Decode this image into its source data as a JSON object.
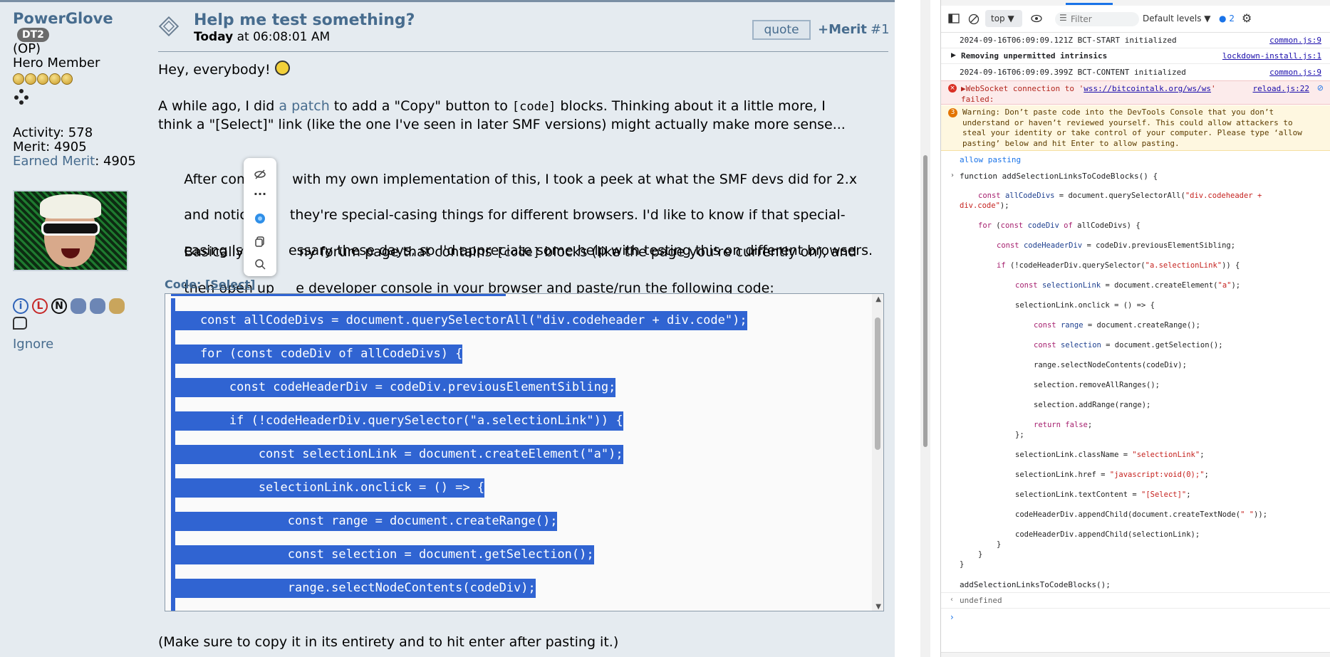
{
  "forum": {
    "poster": {
      "name": "PowerGlove",
      "badge": "DT2",
      "op": "(OP)",
      "rank": "Hero Member",
      "activity": "Activity: 578",
      "merit": "Merit: 4905",
      "earned_label": "Earned Merit",
      "earned_value": ": 4905",
      "ignore": "Ignore"
    },
    "post": {
      "title": "Help me test something?",
      "date_day": "Today",
      "date_time": " at 06:08:01 AM",
      "quote_label": "quote",
      "merit_label": "+Merit",
      "post_number": "#1",
      "p1": "Hey, everybody! ",
      "p2a": "A while ago, I did ",
      "p2_link": "a patch",
      "p2b": " to add a \"Copy\" button to ",
      "p2_code": "[code]",
      "p2c": " blocks. Thinking about it a little more, I",
      "p2d": "think a \"[Select]\" link (like the one I've seen in later SMF versions) might actually make more sense...",
      "p3a": "After coming     with my own implementation of this, I took a peek at what the SMF devs did for 2.x",
      "p3b": "and noticed      they're special-casing things for different browsers. I'd like to know if that special-",
      "p3c": "casing is stil     essary these days, so I'd appreciate some help with testing this on different browsers.",
      "p4a": "Basically, go       ny forum page that contains ",
      "p4_code": "[code]",
      "p4b": " blocks (like the page you're currently on), and",
      "p4c": "then open up     e developer console in your browser and paste/run the following code:",
      "code_label": "Code:",
      "code_select": "[Select]",
      "code_lines": [
        "    const allCodeDivs = document.querySelectorAll(\"div.codeheader + div.code\");",
        "    for (const codeDiv of allCodeDivs) {",
        "        const codeHeaderDiv = codeDiv.previousElementSibling;",
        "        if (!codeHeaderDiv.querySelector(\"a.selectionLink\")) {",
        "            const selectionLink = document.createElement(\"a\");",
        "            selectionLink.onclick = () => {",
        "                const range = document.createRange();",
        "                const selection = document.getSelection();",
        "                range.selectNodeContents(codeDiv);"
      ],
      "footer_note": "(Make sure to copy it in its entirety and to hit enter after pasting it.)"
    }
  },
  "devtools": {
    "context": "top",
    "filter_placeholder": "Filter",
    "levels": "Default levels",
    "issues_count": "2",
    "logs": [
      {
        "text": "2024-09-16T06:09:09.121Z BCT-START initialized",
        "src": "common.js:9"
      },
      {
        "text": "Removing unpermitted intrinsics",
        "src": "lockdown-install.js:1"
      },
      {
        "text": "2024-09-16T06:09:09.399Z BCT-CONTENT initialized",
        "src": "common.js:9"
      }
    ],
    "error": {
      "prefix": "WebSocket connection to '",
      "url": "wss://bitcointalk.org/ws/ws",
      "suffix": "'",
      "second": "failed:",
      "src": "reload.js:22"
    },
    "warning": {
      "count": "3",
      "lines": [
        "Warning: Don’t paste code into the DevTools Console that you don’t",
        "understand or haven’t reviewed yourself. This could allow attackers to",
        "steal your identity or take control of your computer. Please type ‘allow",
        "pasting’ below and hit Enter to allow pasting."
      ]
    },
    "allow_pasting": "allow pasting",
    "fn_header": "function addSelectionLinksToCodeBlocks() {",
    "call": "addSelectionLinksToCodeBlocks();",
    "result": "undefined"
  }
}
